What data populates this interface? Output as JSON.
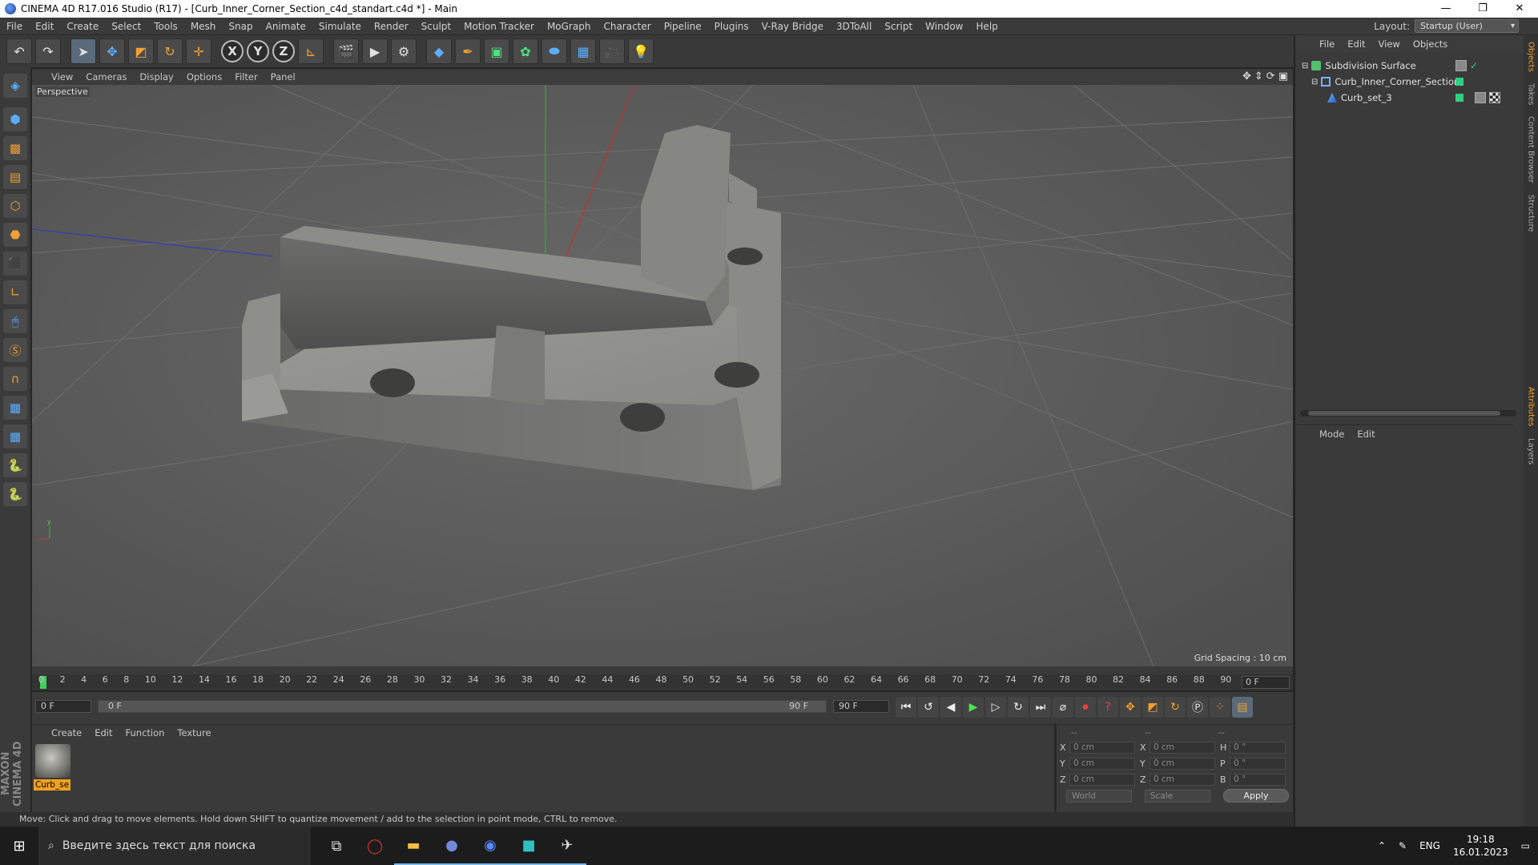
{
  "window": {
    "title": "CINEMA 4D R17.016 Studio (R17) - [Curb_Inner_Corner_Section_c4d_standart.c4d *] - Main",
    "controls": [
      "—",
      "❐",
      "✕"
    ]
  },
  "menubar": {
    "items": [
      "File",
      "Edit",
      "Create",
      "Select",
      "Tools",
      "Mesh",
      "Snap",
      "Animate",
      "Simulate",
      "Render",
      "Sculpt",
      "Motion Tracker",
      "MoGraph",
      "Character",
      "Pipeline",
      "Plugins",
      "V-Ray Bridge",
      "3DToAll",
      "Script",
      "Window",
      "Help"
    ],
    "layout_label": "Layout:",
    "layout_value": "Startup (User)"
  },
  "toolbar": {
    "undo": "↶",
    "redo": "↷",
    "axis_x": "X",
    "axis_y": "Y",
    "axis_z": "Z"
  },
  "viewport": {
    "menu": [
      "View",
      "Cameras",
      "Display",
      "Options",
      "Filter",
      "Panel"
    ],
    "label": "Perspective",
    "grid_spacing": "Grid Spacing : 10 cm"
  },
  "timeline": {
    "ticks": [
      "0",
      "2",
      "4",
      "6",
      "8",
      "10",
      "12",
      "14",
      "16",
      "18",
      "20",
      "22",
      "24",
      "26",
      "28",
      "30",
      "32",
      "34",
      "36",
      "38",
      "40",
      "42",
      "44",
      "46",
      "48",
      "50",
      "52",
      "54",
      "56",
      "58",
      "60",
      "62",
      "64",
      "66",
      "68",
      "70",
      "72",
      "74",
      "76",
      "78",
      "80",
      "82",
      "84",
      "86",
      "88",
      "90"
    ],
    "end_field": "0 F"
  },
  "transport": {
    "current_frame": "0 F",
    "range_start": "0 F",
    "range_end": "90 F",
    "max_frame": "90 F"
  },
  "material_panel": {
    "menu": [
      "Create",
      "Edit",
      "Function",
      "Texture"
    ],
    "material_name": "Curb_se"
  },
  "coordinates": {
    "header": [
      "--",
      "--",
      "--"
    ],
    "rows": [
      {
        "a1": "X",
        "v1": "0 cm",
        "a2": "X",
        "v2": "0 cm",
        "a3": "H",
        "v3": "0 °"
      },
      {
        "a1": "Y",
        "v1": "0 cm",
        "a2": "Y",
        "v2": "0 cm",
        "a3": "P",
        "v3": "0 °"
      },
      {
        "a1": "Z",
        "v1": "0 cm",
        "a2": "Z",
        "v2": "0 cm",
        "a3": "B",
        "v3": "0 °"
      }
    ],
    "mode_world": "World",
    "mode_scale": "Scale",
    "apply": "Apply"
  },
  "status": "Move: Click and drag to move elements. Hold down SHIFT to quantize movement / add to the selection in point mode, CTRL to remove.",
  "brand": "MAXON CINEMA 4D",
  "object_manager": {
    "menu": [
      "File",
      "Edit",
      "View",
      "Objects"
    ],
    "objects": [
      {
        "name": "Subdivision Surface",
        "indent": 0
      },
      {
        "name": "Curb_Inner_Corner_Section",
        "indent": 1
      },
      {
        "name": "Curb_set_3",
        "indent": 2
      }
    ]
  },
  "attributes": {
    "menu": [
      "Mode",
      "Edit"
    ]
  },
  "side_tabs": [
    "Objects",
    "Takes",
    "Content Browser",
    "Structure",
    "Attributes",
    "Layers"
  ],
  "taskbar": {
    "search_placeholder": "Введите здесь текст для поиска",
    "lang": "ENG",
    "time": "19:18",
    "date": "16.01.2023"
  }
}
